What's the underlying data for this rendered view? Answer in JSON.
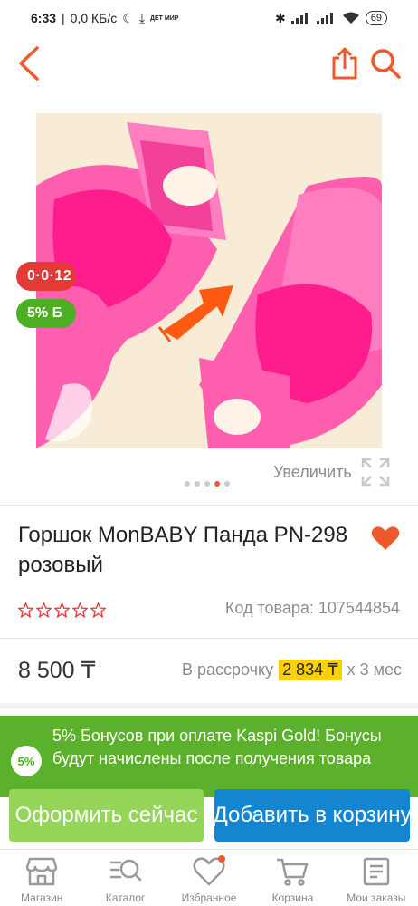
{
  "status_bar": {
    "time": "6:33",
    "speed": "0,0 КБ/с",
    "mini_logo": "ДЕТ МИР",
    "battery": "69"
  },
  "header": {
    "back_icon": "chevron-left-icon",
    "share_icon": "share-icon",
    "search_icon": "search-icon",
    "accent": "#f0592b"
  },
  "badges": {
    "installment": "0·0·12",
    "bonus": "5% Б"
  },
  "gallery": {
    "zoom_label": "Увеличить",
    "total": 5,
    "active_index": 3
  },
  "product": {
    "title": "Горшок MonBABY Панда PN-298 розовый",
    "code_label": "Код товара: 107544854",
    "rating": 0,
    "rating_max": 5,
    "price": "8 500 ₸",
    "installment_prefix": "В рассрочку",
    "installment_amount": "2 834 ₸",
    "installment_suffix": "x 3 мес"
  },
  "bonus_banner": {
    "icon_text": "5%",
    "text": "5% Бонусов при оплате Kaspi Gold! Бонусы будут начислены после получения товара"
  },
  "actions": {
    "buy_now": "Оформить сейчас",
    "add_to_cart": "Добавить в корзину"
  },
  "bottom_nav": [
    {
      "icon": "store-icon",
      "label": "Магазин"
    },
    {
      "icon": "catalog-search-icon",
      "label": "Каталог"
    },
    {
      "icon": "heart-outline-icon",
      "label": "Избранное"
    },
    {
      "icon": "cart-icon",
      "label": "Корзина"
    },
    {
      "icon": "document-icon",
      "label": "Мои заказы"
    }
  ],
  "colors": {
    "accent": "#f0592b",
    "green": "#5bb12c",
    "blue": "#1486d1",
    "red": "#e53935"
  }
}
